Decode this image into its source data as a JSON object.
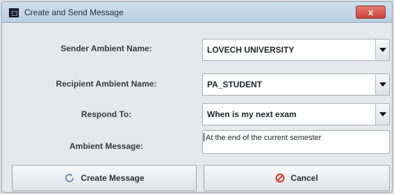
{
  "window": {
    "title": "Create and Send Message",
    "close_glyph": "x"
  },
  "form": {
    "sender_label": "Sender Ambient Name:",
    "sender_value": "LOVECH UNIVERSITY",
    "recipient_label": "Recipient Ambient Name:",
    "recipient_value": "PA_STUDENT",
    "respond_label": "Respond To:",
    "respond_value": "When is my next exam",
    "message_label": "Ambient Message:",
    "message_value": "At the end of the current semester"
  },
  "buttons": {
    "create_label": "Create Message",
    "cancel_label": "Cancel"
  },
  "icons": {
    "app": "window-app-icon",
    "close": "close-icon",
    "dropdown": "chevron-down-icon",
    "create": "refresh-icon",
    "cancel": "cancel-icon"
  },
  "colors": {
    "close_button": "#c9443c",
    "cancel_icon": "#d9332b",
    "create_icon": "#6d8fb8"
  }
}
